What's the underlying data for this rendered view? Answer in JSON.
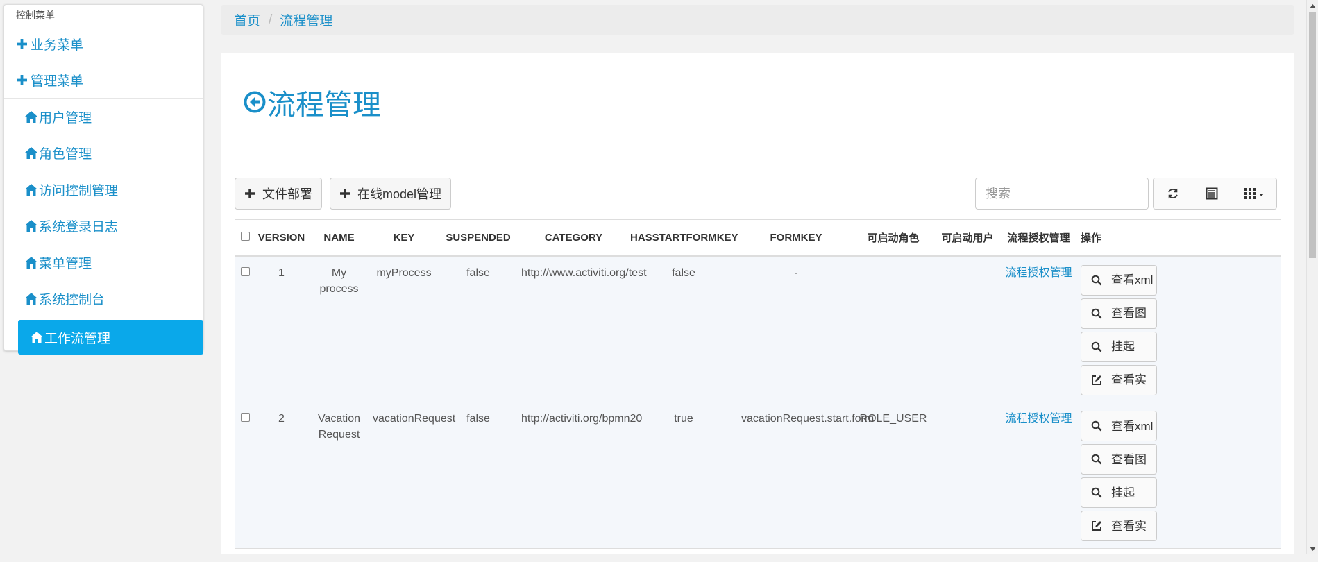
{
  "sidebar": {
    "heading": "控制菜单",
    "groups": [
      {
        "label": "业务菜单"
      },
      {
        "label": "管理菜单"
      }
    ],
    "items": [
      {
        "label": "用户管理"
      },
      {
        "label": "角色管理"
      },
      {
        "label": "访问控制管理"
      },
      {
        "label": "系统登录日志"
      },
      {
        "label": "菜单管理"
      },
      {
        "label": "系统控制台"
      },
      {
        "label": "工作流管理",
        "active": true
      }
    ]
  },
  "breadcrumb": {
    "home": "首页",
    "separator": "/",
    "current": "流程管理"
  },
  "page": {
    "title": "流程管理",
    "title_icon": "arrow-circle-left-icon"
  },
  "toolbar": {
    "deploy_label": "文件部署",
    "model_label": "在线model管理",
    "search_placeholder": "搜索",
    "refresh_icon": "refresh-icon",
    "toggle_icon": "list-toggle-icon",
    "columns_icon": "columns-grid-icon"
  },
  "table": {
    "columns": [
      "VERSION",
      "NAME",
      "KEY",
      "SUSPENDED",
      "CATEGORY",
      "HASSTARTFORMKEY",
      "FORMKEY",
      "可启动角色",
      "可启动用户",
      "流程授权管理",
      "操作"
    ],
    "rows": [
      {
        "version": "1",
        "name": "My process",
        "key": "myProcess",
        "suspended": "false",
        "category": "http://www.activiti.org/test",
        "hasstartformkey": "false",
        "formkey": "-",
        "roles": "",
        "users": "",
        "auth": "流程授权管理",
        "actions": [
          "查看xml",
          "查看图",
          "挂起",
          "查看实"
        ]
      },
      {
        "version": "2",
        "name": "Vacation Request",
        "key": "vacationRequest",
        "suspended": "false",
        "category": "http://activiti.org/bpmn20",
        "hasstartformkey": "true",
        "formkey": "vacationRequest.start.form",
        "roles": "ROLE_USER",
        "users": "",
        "auth": "流程授权管理",
        "actions": [
          "查看xml",
          "查看图",
          "挂起",
          "查看实"
        ]
      }
    ]
  },
  "colors": {
    "accent": "#1a8fc9",
    "active_bg": "#0aa8ea",
    "row_bg": "#f4f7fb"
  }
}
